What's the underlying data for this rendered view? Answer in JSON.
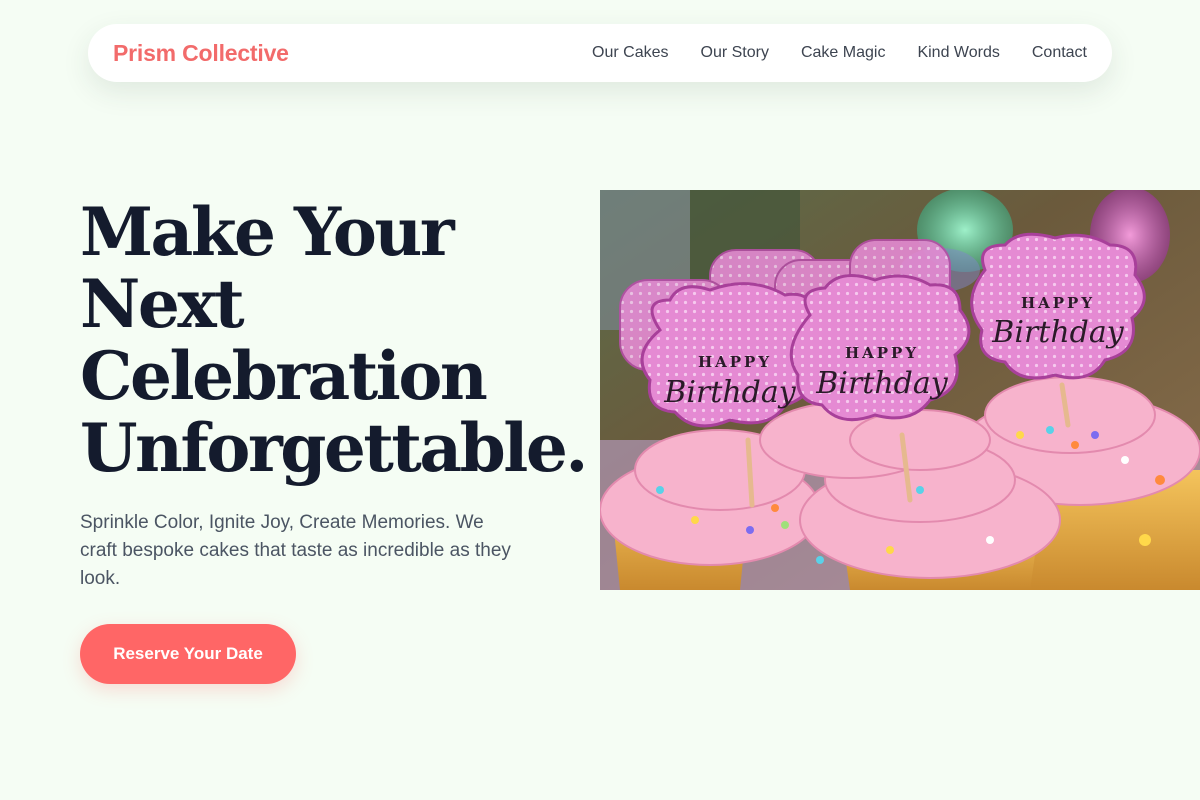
{
  "brand": {
    "name": "Prism Collective",
    "color": "#f26b6b"
  },
  "nav": {
    "items": [
      {
        "label": "Our Cakes"
      },
      {
        "label": "Our Story"
      },
      {
        "label": "Cake Magic"
      },
      {
        "label": "Kind Words"
      },
      {
        "label": "Contact"
      }
    ]
  },
  "hero": {
    "title_lines": [
      "Make Your",
      "Next",
      "Celebration",
      "Unforgettable."
    ],
    "subtitle": "Sprinkle Color, Ignite Joy, Create Memories. We craft bespoke cakes that taste as incredible as they look.",
    "cta_label": "Reserve Your Date",
    "image": {
      "subject": "pink-frosted cupcakes with Happy Birthday toppers",
      "topper_text_top": "HAPPY",
      "topper_text_script": "Birthday"
    }
  },
  "colors": {
    "background": "#f5fdf4",
    "accent": "#ff6666",
    "heading": "#141b2d",
    "body_text": "#4b5563",
    "topper_pink": "#e37fd0",
    "frosting_pink": "#f7b3cc"
  }
}
